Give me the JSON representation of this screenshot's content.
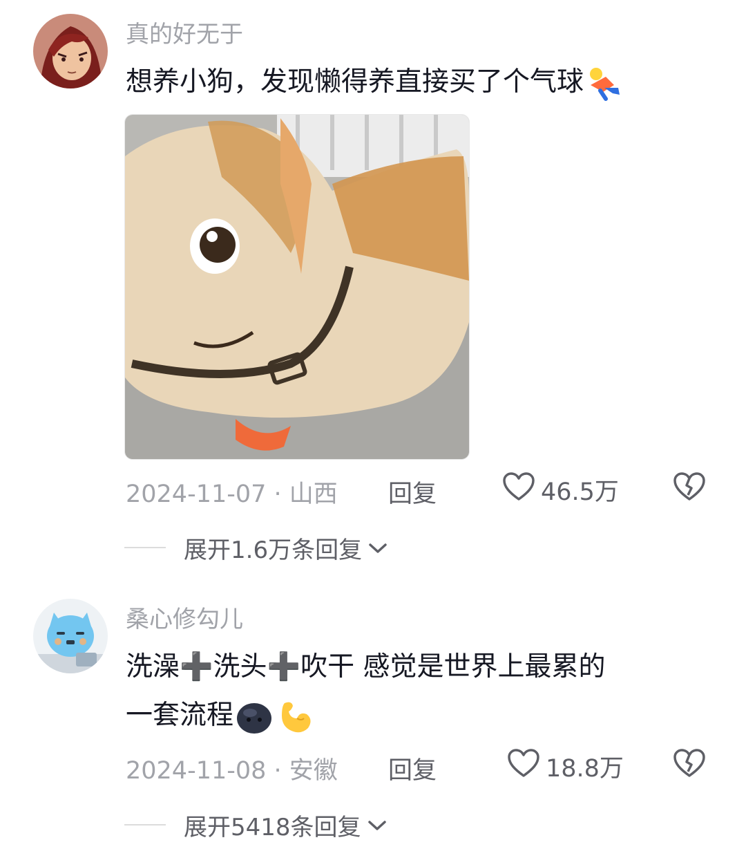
{
  "comments": [
    {
      "username": "真的好无于",
      "text": "想养小狗，发现懒得养直接买了个气球",
      "emojis": [
        "flying-figure-emoji"
      ],
      "date_location": "2024-11-07 · 山西",
      "reply_label": "回复",
      "likes": "46.5万",
      "expand_label": "展开1.6万条回复"
    },
    {
      "username": "桑心修勾儿",
      "text_line1": "洗澡➕洗头➕吹干  感觉是世界上最累的",
      "text_line2": "一套流程",
      "emojis": [
        "dark-blob-face-emoji",
        "flexed-arm-emoji"
      ],
      "date_location": "2024-11-08 · 安徽",
      "reply_label": "回复",
      "likes": "18.8万",
      "expand_label": "展开5418条回复"
    }
  ],
  "icons": {
    "like": "heart-outline-icon",
    "dislike": "broken-heart-icon",
    "expand": "chevron-down-icon"
  },
  "colors": {
    "username": "#a1a3a9",
    "text": "#161823",
    "meta": "#a1a3a9",
    "action": "#5e5f66"
  }
}
